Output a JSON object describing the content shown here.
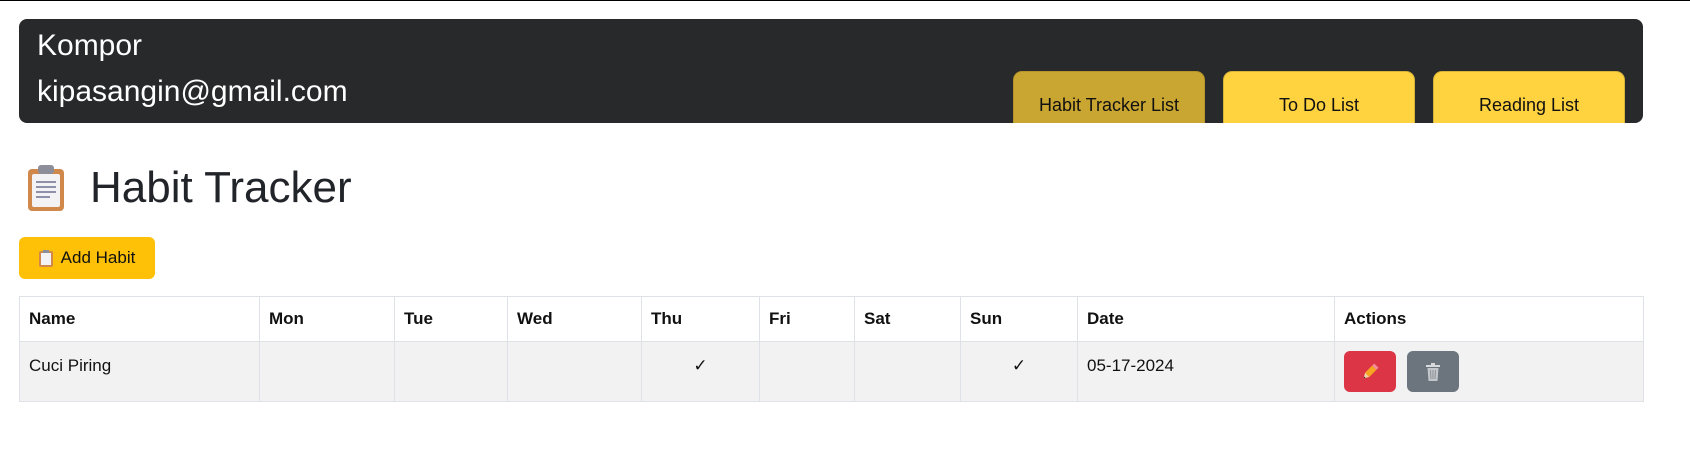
{
  "header": {
    "user_name": "Kompor",
    "user_email": "kipasangin@gmail.com",
    "tabs": [
      {
        "label": "Habit Tracker List",
        "active": true
      },
      {
        "label": "To Do List",
        "active": false
      },
      {
        "label": "Reading List",
        "active": false
      }
    ]
  },
  "page": {
    "title": "Habit Tracker",
    "title_icon": "clipboard-icon",
    "add_button_label": "Add Habit",
    "add_button_icon": "clipboard-icon"
  },
  "table": {
    "columns": [
      "Name",
      "Mon",
      "Tue",
      "Wed",
      "Thu",
      "Fri",
      "Sat",
      "Sun",
      "Date",
      "Actions"
    ],
    "rows": [
      {
        "name": "Cuci Piring",
        "mon": "",
        "tue": "",
        "wed": "",
        "thu": "✓",
        "fri": "",
        "sat": "",
        "sun": "✓",
        "date": "05-17-2024",
        "actions": [
          {
            "icon": "pencil-icon",
            "color": "#dc3545"
          },
          {
            "icon": "trash-icon",
            "color": "#6c757d"
          }
        ]
      }
    ]
  },
  "colors": {
    "header_bg": "#28292b",
    "tab_bg": "#ffd23f",
    "tab_active_bg": "#c9a531",
    "add_button_bg": "#ffc107",
    "edit_button_bg": "#dc3545",
    "delete_button_bg": "#6c757d"
  }
}
